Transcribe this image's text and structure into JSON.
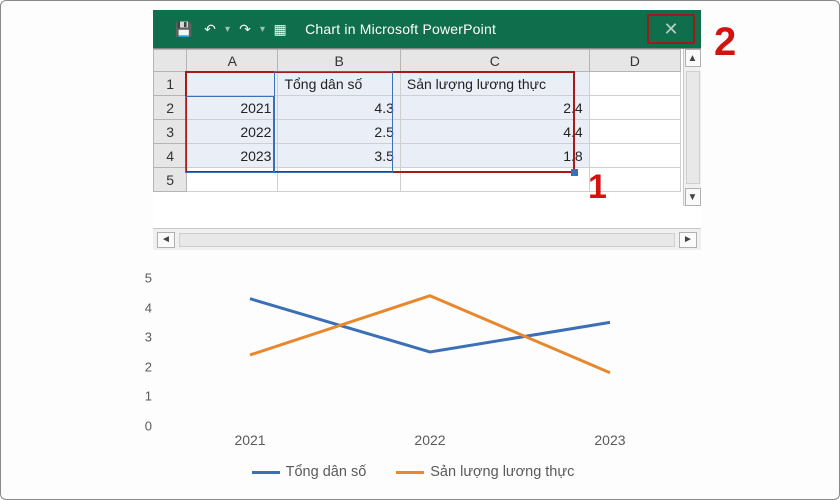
{
  "window": {
    "title": "Chart in Microsoft PowerPoint",
    "icons": {
      "save": "💾",
      "undo": "↶",
      "redo": "↷",
      "grid": "▦",
      "close": "✕",
      "dd": "▾",
      "left": "◄",
      "right": "►",
      "up": "▲",
      "down": "▼"
    }
  },
  "annotations": {
    "one": "1",
    "two": "2"
  },
  "sheet": {
    "colHeaders": {
      "a": "A",
      "b": "B",
      "c": "C",
      "d": "D"
    },
    "rowHeaders": {
      "r1": "1",
      "r2": "2",
      "r3": "3",
      "r4": "4",
      "r5": "5"
    },
    "headerRow": {
      "b": "Tổng dân số",
      "c": "Sản lượng lương thực"
    },
    "rows": [
      {
        "a": "2021",
        "b": "4.3",
        "c": "2.4"
      },
      {
        "a": "2022",
        "b": "2.5",
        "c": "4.4"
      },
      {
        "a": "2023",
        "b": "3.5",
        "c": "1.8"
      }
    ]
  },
  "chart_data": {
    "type": "line",
    "categories": [
      "2021",
      "2022",
      "2023"
    ],
    "series": [
      {
        "name": "Tổng dân số",
        "values": [
          4.3,
          2.5,
          3.5
        ],
        "color": "#3b6fb6"
      },
      {
        "name": "Sản lượng lương thực",
        "values": [
          2.4,
          4.4,
          1.8
        ],
        "color": "#e8882e"
      }
    ],
    "ylim": [
      0,
      5
    ],
    "yticks": [
      0,
      1,
      2,
      3,
      4,
      5
    ],
    "xlabel": "",
    "ylabel": "",
    "title": ""
  },
  "chartLabels": {
    "y0": "0",
    "y1": "1",
    "y2": "2",
    "y3": "3",
    "y4": "4",
    "y5": "5",
    "x0": "2021",
    "x1": "2022",
    "x2": "2023",
    "legendA": "Tổng dân số",
    "legendB": "Sản lượng lương thực"
  },
  "colors": {
    "seriesA": "#3b6fb6",
    "seriesB": "#e8882e"
  }
}
